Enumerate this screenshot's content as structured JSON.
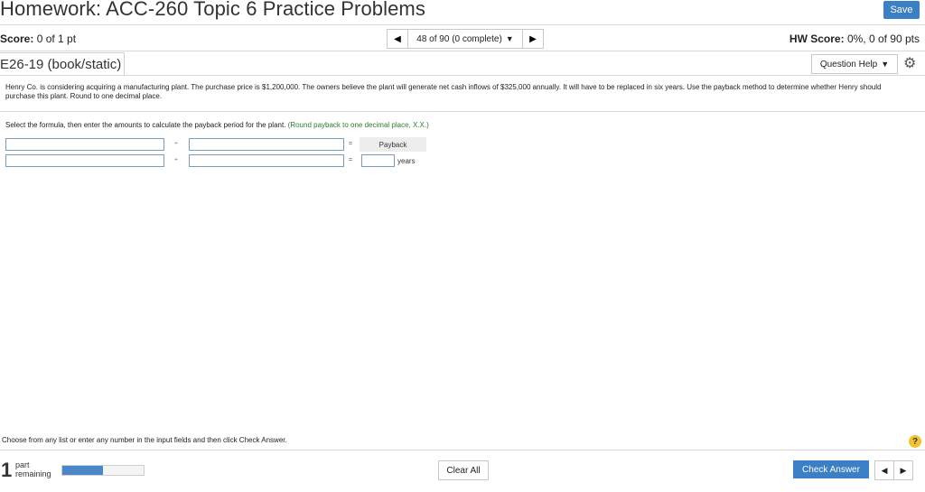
{
  "header": {
    "title": "Homework: ACC-260 Topic 6 Practice Problems",
    "save_label": "Save"
  },
  "score": {
    "label": "Score:",
    "value": "0 of 1 pt"
  },
  "navigator": {
    "position": "48 of 90 (0 complete)"
  },
  "hw_score": {
    "label": "HW Score:",
    "value": "0%, 0 of 90 pts"
  },
  "problem": {
    "id": "E26-19 (book/static)",
    "question_help_label": "Question Help",
    "text": "Henry Co. is considering acquiring a manufacturing plant. The purchase price is $1,200,000. The owners believe the plant will generate net cash inflows of $325,000 annually. It will have to be replaced in six years. Use the payback method to determine whether Henry should purchase this plant. Round to one decimal place.",
    "instruction": "Select the formula, then enter the amounts to calculate the payback period for the plant.",
    "hint": "(Round payback to one decimal place, X.X.)"
  },
  "formula": {
    "row1": {
      "operator": "÷",
      "equals": "=",
      "result_label": "Payback"
    },
    "row2": {
      "operator": "÷",
      "equals": "=",
      "unit": "years"
    }
  },
  "footer": {
    "instruction": "Choose from any list or enter any number in the input fields and then click Check Answer.",
    "parts_count": "1",
    "parts_label_line1": "part",
    "parts_label_line2": "remaining",
    "progress_fraction": 0.5,
    "clear_label": "Clear All",
    "check_label": "Check Answer",
    "help_symbol": "?"
  },
  "colors": {
    "accent": "#3b7fc4",
    "hint_green": "#2e7d32",
    "help_yellow": "#f2c230"
  }
}
